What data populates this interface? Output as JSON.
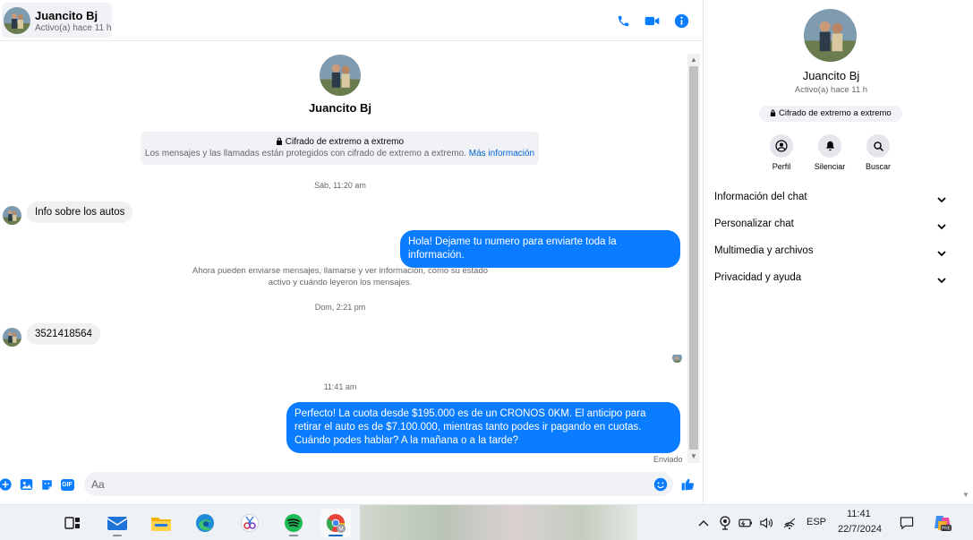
{
  "contact": {
    "name": "Juancito Bj",
    "status": "Activo(a) hace 11 h"
  },
  "conversation": {
    "encryption_title": "Cifrado de extremo a extremo",
    "encryption_text": "Los mensajes y las llamadas están protegidos con cifrado de extremo a extremo.",
    "encryption_link": "Más información",
    "timestamps": [
      "Sáb, 11:20 am",
      "Dom, 2:21 pm",
      "11:41 am"
    ],
    "system_note": "Ahora pueden enviarse mensajes, llamarse y ver información, como su estado activo y cuándo leyeron los mensajes.",
    "messages": [
      {
        "direction": "in",
        "text": "Info sobre los autos"
      },
      {
        "direction": "out",
        "text": "Hola! Dejame tu numero  para enviarte toda la información."
      },
      {
        "direction": "in",
        "text": "3521418564"
      },
      {
        "direction": "out",
        "text": "Perfecto! La cuota desde $195.000 es de un CRONOS 0KM. El anticipo para retirar el auto es de $7.100.000, mientras tanto podes ir pagando en cuotas. Cuándo podes hablar? A la mañana o a la tarde?"
      }
    ],
    "sent_status": "Enviado"
  },
  "composer": {
    "placeholder": "Aa",
    "gif_label": "GIF"
  },
  "info_panel": {
    "encryption_badge": "Cifrado de extremo a extremo",
    "actions": [
      {
        "label": "Perfil",
        "icon": "profile-icon"
      },
      {
        "label": "Silenciar",
        "icon": "bell-icon"
      },
      {
        "label": "Buscar",
        "icon": "search-icon"
      }
    ],
    "sections": [
      "Información del chat",
      "Personalizar chat",
      "Multimedia y archivos",
      "Privacidad y ayuda"
    ]
  },
  "taskbar": {
    "apps": [
      "task-view",
      "mail",
      "file-explorer",
      "edge",
      "snipping-tool",
      "spotify",
      "chrome"
    ],
    "language": "ESP",
    "time": "11:41",
    "date": "22/7/2024",
    "copilot_badge": "PRE"
  },
  "colors": {
    "accent": "#0a7cff",
    "incoming_bubble": "#f0f0f0",
    "secondary_text": "#65676b"
  }
}
